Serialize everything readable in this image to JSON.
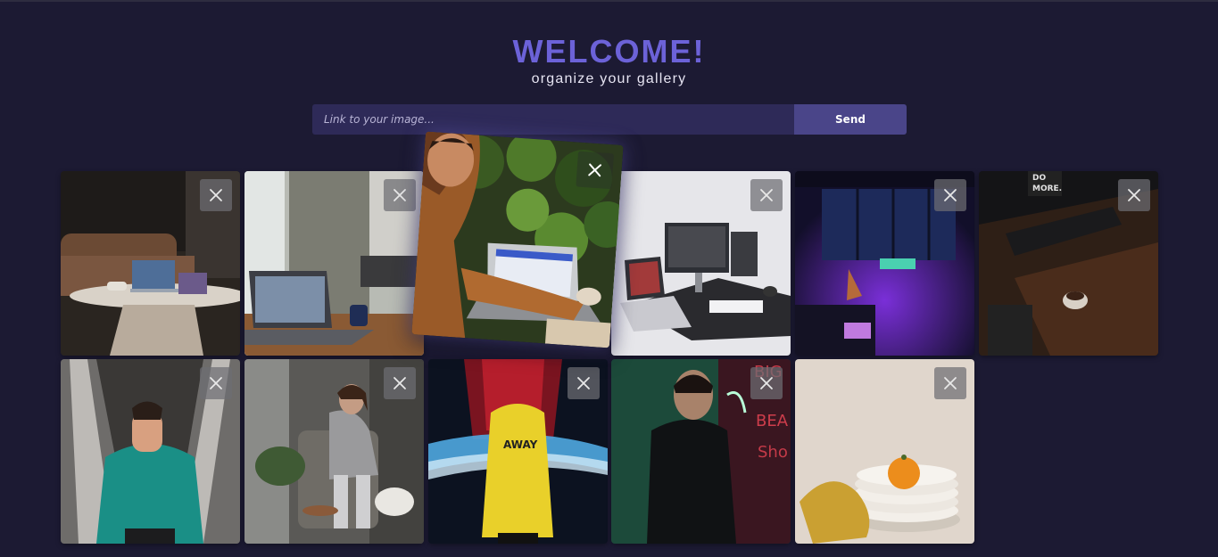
{
  "header": {
    "title": "WELCOME!",
    "subtitle": "organize your gallery",
    "title_color": "#6c62d8"
  },
  "form": {
    "placeholder": "Link to your image...",
    "value": "",
    "send_label": "Send"
  },
  "gallery": {
    "images": [
      {
        "name": "living room with laptop on coffee table",
        "state": "normal"
      },
      {
        "name": "laptop on wooden desk by window",
        "state": "normal"
      },
      {
        "name": "man working on laptop by plant wall",
        "state": "hovered-zoomed"
      },
      {
        "name": "white desk with monitors and laptops",
        "state": "normal"
      },
      {
        "name": "neon purple studio room at night",
        "state": "normal"
      },
      {
        "name": "dark desk with coffee mug and do more sign",
        "state": "normal"
      },
      {
        "name": "man in teal jacket on escalator",
        "state": "normal"
      },
      {
        "name": "woman in grey sweater reading on chair",
        "state": "normal"
      },
      {
        "name": "person in yellow raincoat in neon street",
        "state": "normal"
      },
      {
        "name": "man in glasses by neon sign",
        "state": "normal"
      },
      {
        "name": "orange on stacked white plates",
        "state": "normal"
      }
    ],
    "close_icon": "close-icon"
  }
}
